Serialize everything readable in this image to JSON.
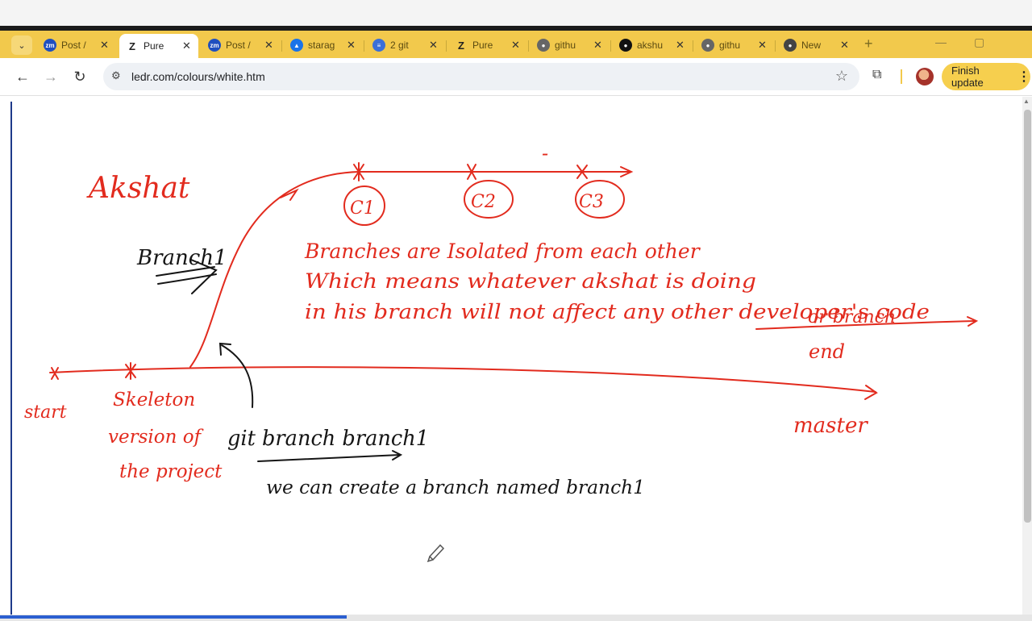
{
  "browser": {
    "tabs": [
      {
        "title": "Post /",
        "icon": "zm-icon",
        "color": "#1f4fbf",
        "active": false
      },
      {
        "title": "Pure",
        "icon": "pure-z-icon",
        "color": "#222222",
        "active": true
      },
      {
        "title": "Post /",
        "icon": "zm-icon",
        "color": "#1f4fbf",
        "active": false
      },
      {
        "title": "starag",
        "icon": "drive-icon",
        "color": "#1a73e8",
        "active": false
      },
      {
        "title": "2 git",
        "icon": "docs-icon",
        "color": "#3b6fd8",
        "active": false
      },
      {
        "title": "Pure",
        "icon": "pure-z-icon",
        "color": "#222222",
        "active": false
      },
      {
        "title": "githu",
        "icon": "globe-icon",
        "color": "#666666",
        "active": false
      },
      {
        "title": "akshu",
        "icon": "github-icon",
        "color": "#111111",
        "active": false
      },
      {
        "title": "githu",
        "icon": "globe-icon",
        "color": "#666666",
        "active": false
      },
      {
        "title": "New",
        "icon": "chrome-icon",
        "color": "#444444",
        "active": false
      }
    ],
    "url": "ledr.com/colours/white.htm",
    "update_label": "Finish update"
  },
  "board": {
    "author": "Akshat",
    "branch_label": "Branch1",
    "commits": [
      "C1",
      "C2",
      "C3"
    ],
    "note_lines": [
      "Branches are Isolated from each other",
      "Which means whatever akshat is doing",
      "in his branch will not affect any other developer's code"
    ],
    "note_tail": "or branch",
    "end_label": "end",
    "start_label": "start",
    "skeleton_lines": [
      "Skeleton",
      "version of",
      "the project"
    ],
    "command": "git branch branch1",
    "command_desc": "we can create a branch named branch1",
    "master_label": "master",
    "dash_mark": "-"
  }
}
